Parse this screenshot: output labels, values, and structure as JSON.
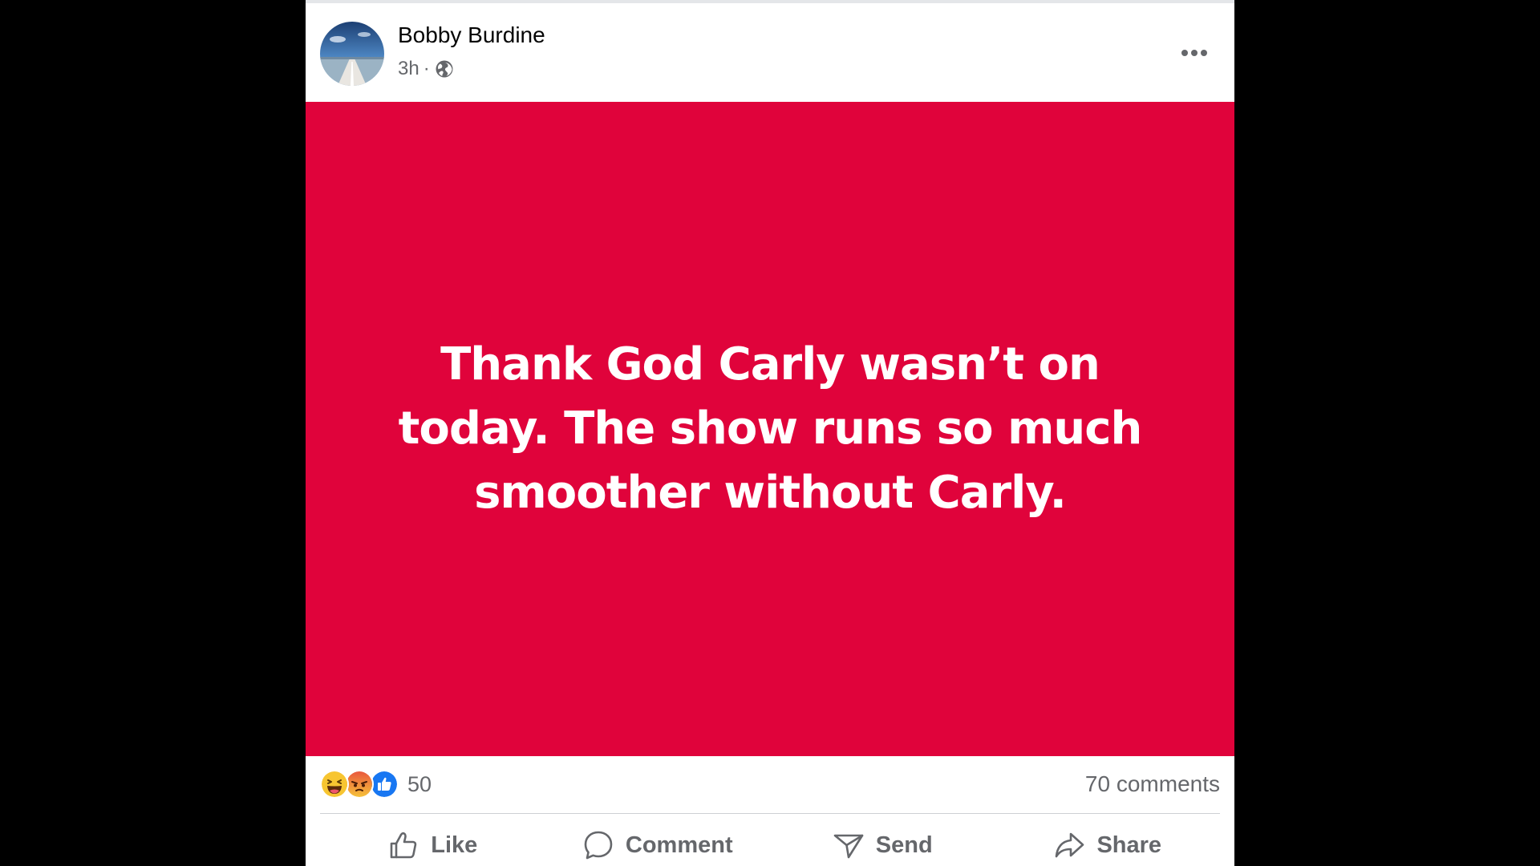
{
  "post": {
    "author": "Bobby Burdine",
    "time": "3h",
    "separator": "·",
    "audience_icon": "globe-icon",
    "more_icon": "more-options-icon",
    "background_color": "#e0033b",
    "text_color": "#ffffff",
    "text": "Thank God Carly wasn’t on today. The show runs so much smoother without Carly."
  },
  "reactions": {
    "types": [
      "haha",
      "angry",
      "like"
    ],
    "count": "50",
    "comments": "70 comments"
  },
  "actions": {
    "like": "Like",
    "comment": "Comment",
    "send": "Send",
    "share": "Share"
  }
}
